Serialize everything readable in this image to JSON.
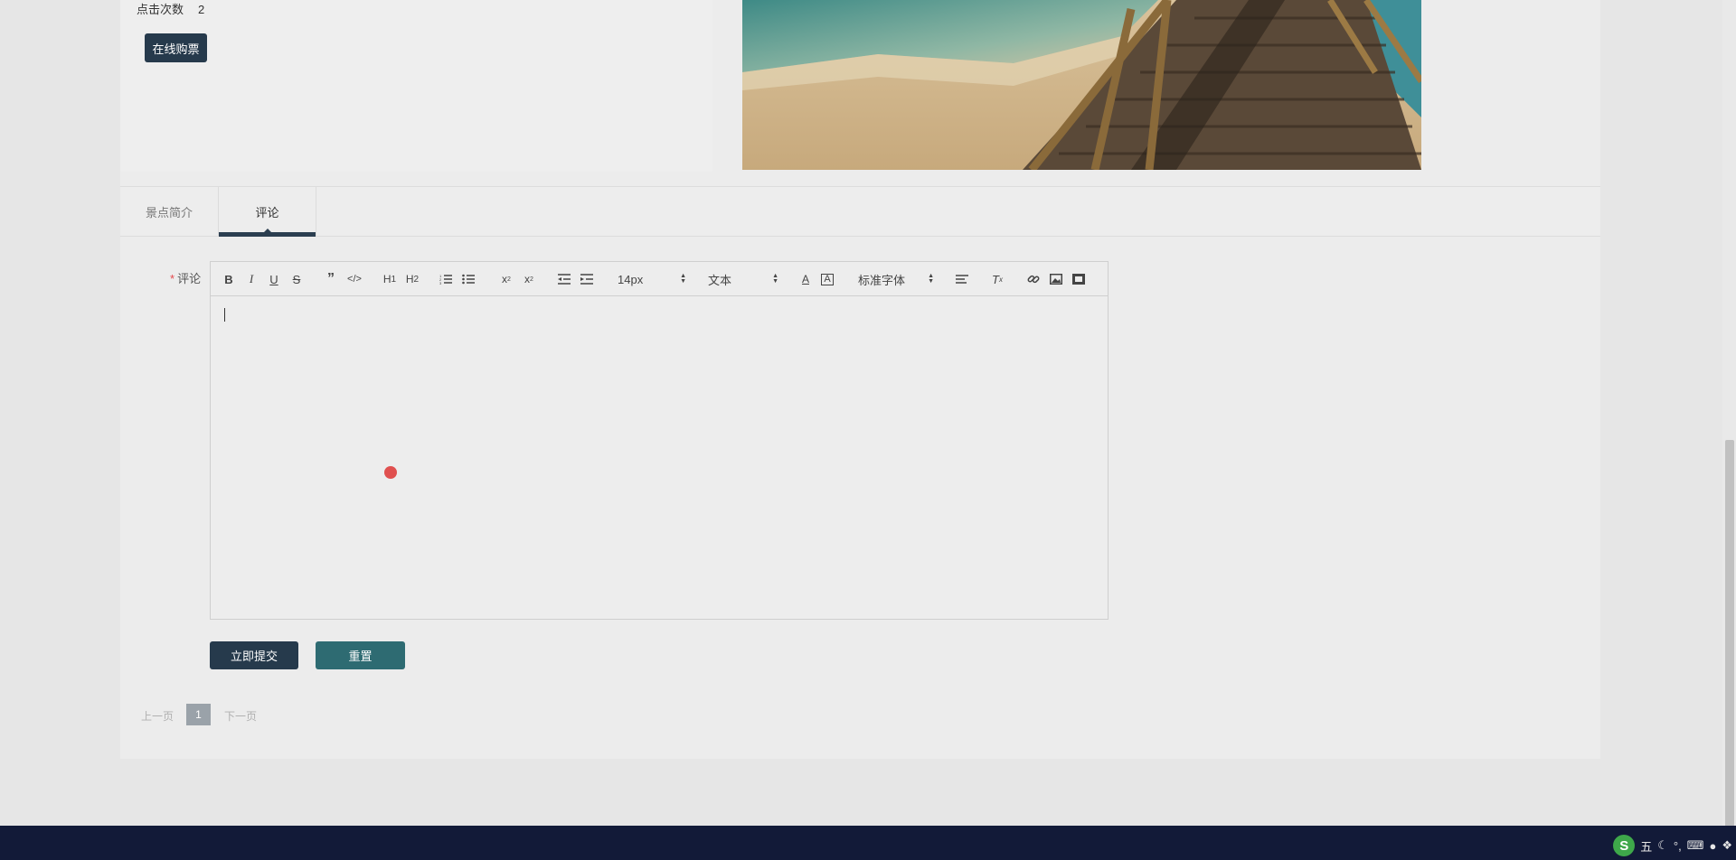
{
  "info": {
    "clicks_label": "点击次数",
    "clicks_value": "2",
    "buy_button": "在线购票"
  },
  "tabs": [
    {
      "label": "景点简介",
      "active": false
    },
    {
      "label": "评论",
      "active": true
    }
  ],
  "form": {
    "required_mark": "*",
    "comment_label": "评论",
    "submit": "立即提交",
    "reset": "重置"
  },
  "toolbar": {
    "icons": [
      "bold-icon",
      "italic-icon",
      "underline-icon",
      "strike-icon",
      "blockquote-icon",
      "code-block-icon",
      "header1-icon",
      "header2-icon",
      "ordered-list-icon",
      "bullet-list-icon",
      "subscript-icon",
      "superscript-icon",
      "outdent-icon",
      "indent-icon",
      "text-color-icon",
      "background-color-icon",
      "align-icon",
      "clean-format-icon",
      "link-icon",
      "image-icon",
      "video-icon"
    ],
    "size_value": "14px",
    "header_value": "文本",
    "font_value": "标准字体"
  },
  "pager": {
    "prev": "上一页",
    "current": "1",
    "next": "下一页"
  },
  "taskbar": {
    "ime_label": "S",
    "ime_mode": "五",
    "colors": {
      "taskbar": "#121a38",
      "primary": "#263a4c",
      "teal": "#2e6b72",
      "required": "#e5484d"
    }
  }
}
